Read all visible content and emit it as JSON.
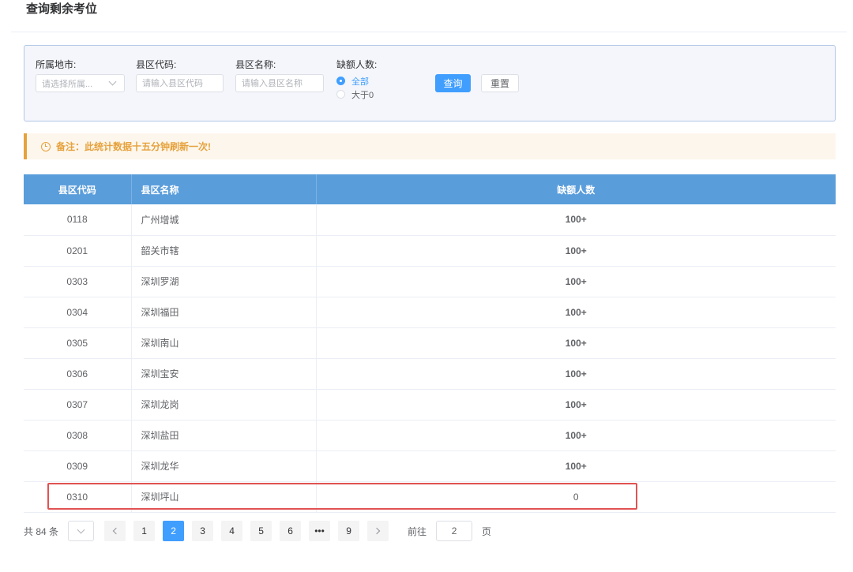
{
  "page": {
    "title": "查询剩余考位"
  },
  "filters": {
    "city": {
      "label": "所属地市:",
      "placeholder": "请选择所属..."
    },
    "county_code": {
      "label": "县区代码:",
      "placeholder": "请输入县区代码"
    },
    "county_name": {
      "label": "县区名称:",
      "placeholder": "请输入县区名称"
    },
    "shortage": {
      "label": "缺额人数:",
      "options": [
        "全部",
        "大于0"
      ],
      "selected": "全部"
    },
    "search_label": "查询",
    "reset_label": "重置"
  },
  "notice": {
    "text": "备注：此统计数据十五分钟刷新一次!"
  },
  "table": {
    "headers": [
      "县区代码",
      "县区名称",
      "缺额人数"
    ],
    "rows": [
      {
        "code": "0118",
        "name": "广州增城",
        "count": "100+"
      },
      {
        "code": "0201",
        "name": "韶关市辖",
        "count": "100+"
      },
      {
        "code": "0303",
        "name": "深圳罗湖",
        "count": "100+"
      },
      {
        "code": "0304",
        "name": "深圳福田",
        "count": "100+"
      },
      {
        "code": "0305",
        "name": "深圳南山",
        "count": "100+"
      },
      {
        "code": "0306",
        "name": "深圳宝安",
        "count": "100+"
      },
      {
        "code": "0307",
        "name": "深圳龙岗",
        "count": "100+"
      },
      {
        "code": "0308",
        "name": "深圳盐田",
        "count": "100+"
      },
      {
        "code": "0309",
        "name": "深圳龙华",
        "count": "100+"
      },
      {
        "code": "0310",
        "name": "深圳坪山",
        "count": "0"
      }
    ]
  },
  "pagination": {
    "total_text": "共 84 条",
    "pages": [
      "1",
      "2",
      "3",
      "4",
      "5",
      "6",
      "•••",
      "9"
    ],
    "current": "2",
    "goto_prefix": "前往",
    "goto_value": "2",
    "goto_suffix": "页"
  },
  "colors": {
    "primary": "#409eff",
    "header_bg": "#5a9ddb",
    "success": "#67c23a",
    "danger": "#f56c6c",
    "warning": "#e6a23c",
    "highlight": "#e15252"
  },
  "icons": {
    "notice": "clock-icon",
    "select": "chevron-down-icon"
  }
}
